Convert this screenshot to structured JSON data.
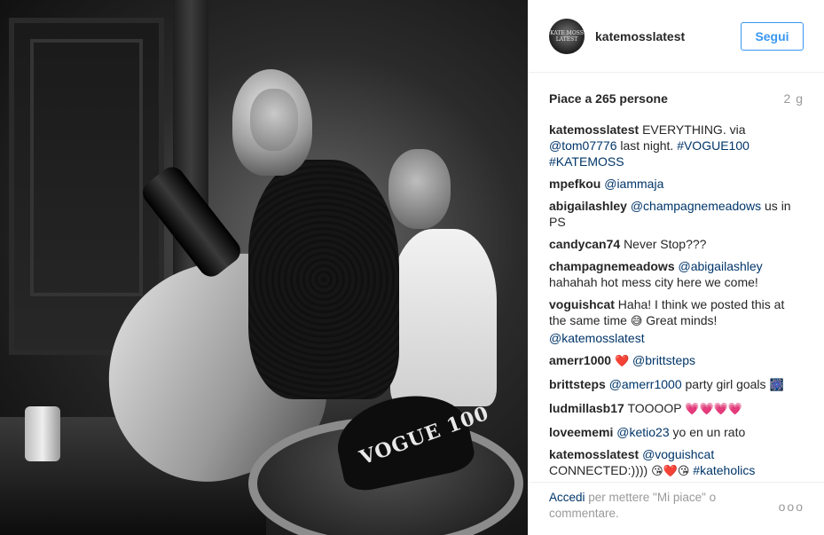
{
  "post": {
    "username": "katemosslatest",
    "avatar_text": "KATE MOSS LATEST",
    "follow_label": "Segui",
    "likes": "Piace a 265 persone",
    "age": "2 g",
    "photo_cap_text": "VOGUE 100"
  },
  "comments": [
    {
      "author": "katemosslatest",
      "parts": [
        {
          "t": "EVERYTHING. via "
        },
        {
          "m": "@tom07776"
        },
        {
          "t": " last night. "
        },
        {
          "m": "#VOGUE100"
        },
        {
          "t": " "
        },
        {
          "m": "#KATEMOSS"
        }
      ]
    },
    {
      "author": "mpefkou",
      "parts": [
        {
          "m": "@iammaja"
        }
      ]
    },
    {
      "author": "abigailashley",
      "parts": [
        {
          "m": "@champagnemeadows"
        },
        {
          "t": " us in PS"
        }
      ]
    },
    {
      "author": "candycan74",
      "parts": [
        {
          "t": "Never Stop???"
        }
      ]
    },
    {
      "author": "champagnemeadows",
      "parts": [
        {
          "m": "@abigailashley"
        },
        {
          "t": " hahahah hot mess city here we come!"
        }
      ]
    },
    {
      "author": "voguishcat",
      "parts": [
        {
          "t": "Haha! I think we posted this at the same time "
        },
        {
          "e": "😅"
        },
        {
          "t": " Great minds! "
        },
        {
          "m": "@katemosslatest"
        }
      ]
    },
    {
      "author": "amerr1000",
      "parts": [
        {
          "e": "❤️"
        },
        {
          "t": " "
        },
        {
          "m": "@brittsteps"
        }
      ]
    },
    {
      "author": "brittsteps",
      "parts": [
        {
          "m": "@amerr1000"
        },
        {
          "t": " party girl goals "
        },
        {
          "e": "🎆"
        }
      ]
    },
    {
      "author": "ludmillasb17",
      "parts": [
        {
          "t": "TOOOOP "
        },
        {
          "e": "💗💗💗💗"
        }
      ]
    },
    {
      "author": "loveememi",
      "parts": [
        {
          "m": "@ketio23"
        },
        {
          "t": " yo en un rato"
        }
      ]
    },
    {
      "author": "katemosslatest",
      "parts": [
        {
          "m": "@voguishcat"
        },
        {
          "t": " CONNECTED:)))) "
        },
        {
          "e": "😘❤️😘"
        },
        {
          "t": " "
        },
        {
          "m": "#kateholics"
        }
      ]
    }
  ],
  "footer": {
    "login_label": "Accedi",
    "rest": " per mettere \"Mi piace\" o commentare.",
    "more_label": "ooo"
  },
  "colors": {
    "link": "#003569",
    "accent": "#3897f0",
    "muted": "#999999",
    "text": "#262626"
  },
  "icons": [
    "more-options-icon"
  ]
}
